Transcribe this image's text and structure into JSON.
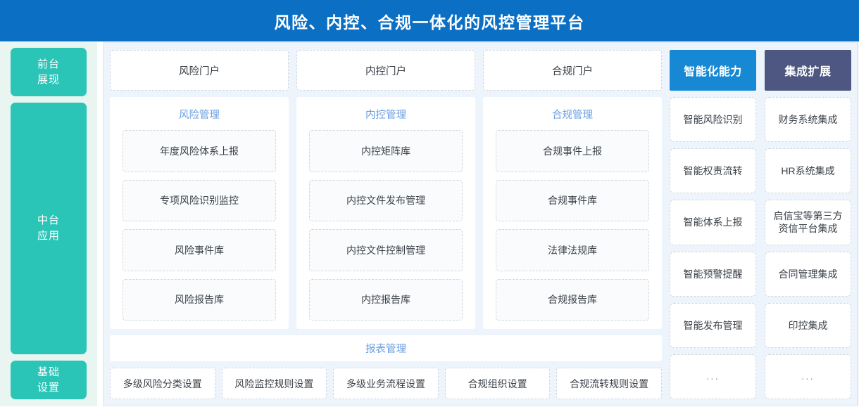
{
  "header": {
    "title": "风险、内控、合规一体化的风控管理平台",
    "bg_color": "#0b70c4"
  },
  "sidebar": {
    "bg_color": "#e9f5f1",
    "item_color": "#2ac5b6",
    "items": [
      {
        "label": "前台\n展现",
        "line1": "前台",
        "line2": "展现"
      },
      {
        "label": "中台\n应用",
        "line1": "中台",
        "line2": "应用"
      },
      {
        "label": "基础\n设置",
        "line1": "基础",
        "line2": "设置"
      }
    ]
  },
  "main": {
    "bg_color": "#edf4fc",
    "portals": [
      {
        "label": "风险门户"
      },
      {
        "label": "内控门户"
      },
      {
        "label": "合规门户"
      }
    ],
    "columns": [
      {
        "title": "风险管理",
        "items": [
          {
            "label": "年度风险体系上报"
          },
          {
            "label": "专项风险识别监控"
          },
          {
            "label": "风险事件库"
          },
          {
            "label": "风险报告库"
          }
        ]
      },
      {
        "title": "内控管理",
        "items": [
          {
            "label": "内控矩阵库"
          },
          {
            "label": "内控文件发布管理"
          },
          {
            "label": "内控文件控制管理"
          },
          {
            "label": "内控报告库"
          }
        ]
      },
      {
        "title": "合规管理",
        "items": [
          {
            "label": "合规事件上报"
          },
          {
            "label": "合规事件库"
          },
          {
            "label": "法律法规库"
          },
          {
            "label": "合规报告库"
          }
        ]
      }
    ],
    "report_bar": {
      "label": "报表管理",
      "color": "#6b9fe0"
    },
    "settings": [
      {
        "label": "多级风险分类设置"
      },
      {
        "label": "风险监控规则设置"
      },
      {
        "label": "多级业务流程设置"
      },
      {
        "label": "合规组织设置"
      },
      {
        "label": "合规流转规则设置"
      }
    ],
    "right_columns": [
      {
        "title": "智能化能力",
        "head_color": "#1789d4",
        "items": [
          {
            "label": "智能风险识别"
          },
          {
            "label": "智能权责流转"
          },
          {
            "label": "智能体系上报"
          },
          {
            "label": "智能预警提醒"
          },
          {
            "label": "智能发布管理"
          },
          {
            "label": "..."
          }
        ]
      },
      {
        "title": "集成扩展",
        "head_color": "#4e5781",
        "items": [
          {
            "label": "财务系统集成"
          },
          {
            "label": "HR系统集成"
          },
          {
            "label": "启信宝等第三方资信平台集成",
            "line1": "启信宝等第三方",
            "line2": "资信平台集成"
          },
          {
            "label": "合同管理集成"
          },
          {
            "label": "印控集成"
          },
          {
            "label": "..."
          }
        ]
      }
    ]
  }
}
